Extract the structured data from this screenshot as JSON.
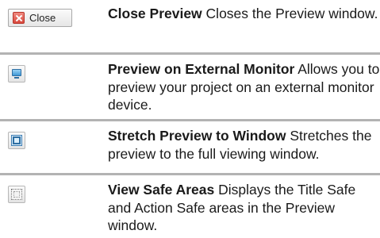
{
  "rows": [
    {
      "title": "Close Preview",
      "description": "Closes the Preview window.",
      "button_label": "Close",
      "icon": "close-x-icon"
    },
    {
      "title": "Preview on External Monitor",
      "description": "Allows you to preview your project on an external monitor device.",
      "icon": "monitor-icon"
    },
    {
      "title": "Stretch Preview to Window",
      "description": "Stretches the preview to the full viewing window.",
      "icon": "stretch-icon"
    },
    {
      "title": "View Safe Areas",
      "description": "Displays the Title Safe and Action Safe areas in the Preview window.",
      "icon": "safe-areas-icon"
    }
  ],
  "colors": {
    "divider": "#b3b3b3",
    "close_red": "#d8483d",
    "icon_blue": "#3f98d6"
  }
}
